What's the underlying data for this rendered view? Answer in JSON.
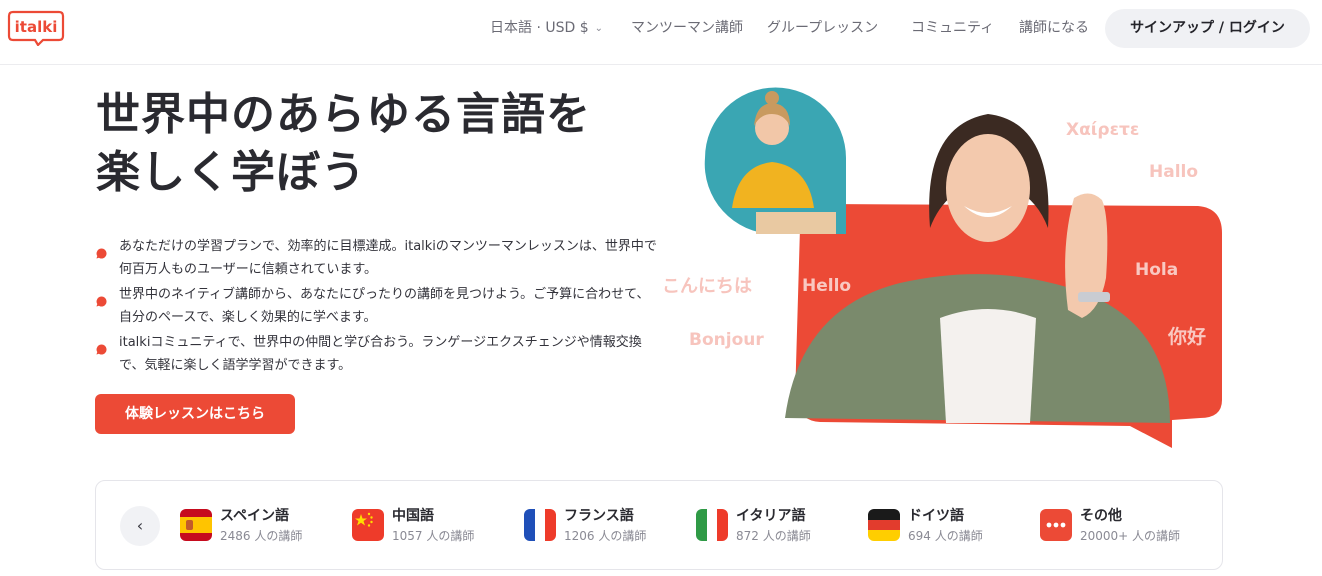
{
  "header": {
    "logo_text": "italki",
    "language_currency": "日本語 · USD $",
    "nav": {
      "tutors": "マンツーマン講師",
      "group": "グループレッスン",
      "community": "コミュニティ",
      "teach": "講師になる"
    },
    "signup_label": "サインアップ / ログイン"
  },
  "hero": {
    "title_line1": "世界中のあらゆる言語を",
    "title_line2": "楽しく学ぼう",
    "features": [
      "あなただけの学習プランで、効率的に目標達成。italkiのマンツーマンレッスンは、世界中で何百万人ものユーザーに信頼されています。",
      "世界中のネイティブ講師から、あなたにぴったりの講師を見つけよう。ご予算に合わせて、自分のペースで、楽しく効果的に学べます。",
      "italkiコミュニティで、世界中の仲間と学び合おう。ランゲージエクスチェンジや情報交換で、気軽に楽しく語学学習ができます。"
    ],
    "cta_label": "体験レッスンはこちら",
    "greetings": {
      "greek": "Χαίρετε",
      "german": "Hallo",
      "japanese": "こんにちは",
      "english": "Hello",
      "spanish": "Hola",
      "french": "Bonjour",
      "chinese": "你好"
    }
  },
  "languages": {
    "prev_icon": "‹",
    "items": [
      {
        "name": "スペイン語",
        "count": "2486 人の講師"
      },
      {
        "name": "中国語",
        "count": "1057 人の講師"
      },
      {
        "name": "フランス語",
        "count": "1206 人の講師"
      },
      {
        "name": "イタリア語",
        "count": "872 人の講師"
      },
      {
        "name": "ドイツ語",
        "count": "694 人の講師"
      },
      {
        "name": "その他",
        "count": "20000+ 人の講師"
      }
    ]
  },
  "colors": {
    "brand_red": "#ec4a36",
    "text_dark": "#2a2a30",
    "text_muted": "#6b6b75",
    "button_grey": "#f0f1f4"
  },
  "icons": [
    "italki-logo",
    "chevron-down-icon",
    "bullet-bubble-icon",
    "chevron-left-icon",
    "spain-flag-icon",
    "china-flag-icon",
    "france-flag-icon",
    "italy-flag-icon",
    "germany-flag-icon",
    "more-dots-icon"
  ]
}
